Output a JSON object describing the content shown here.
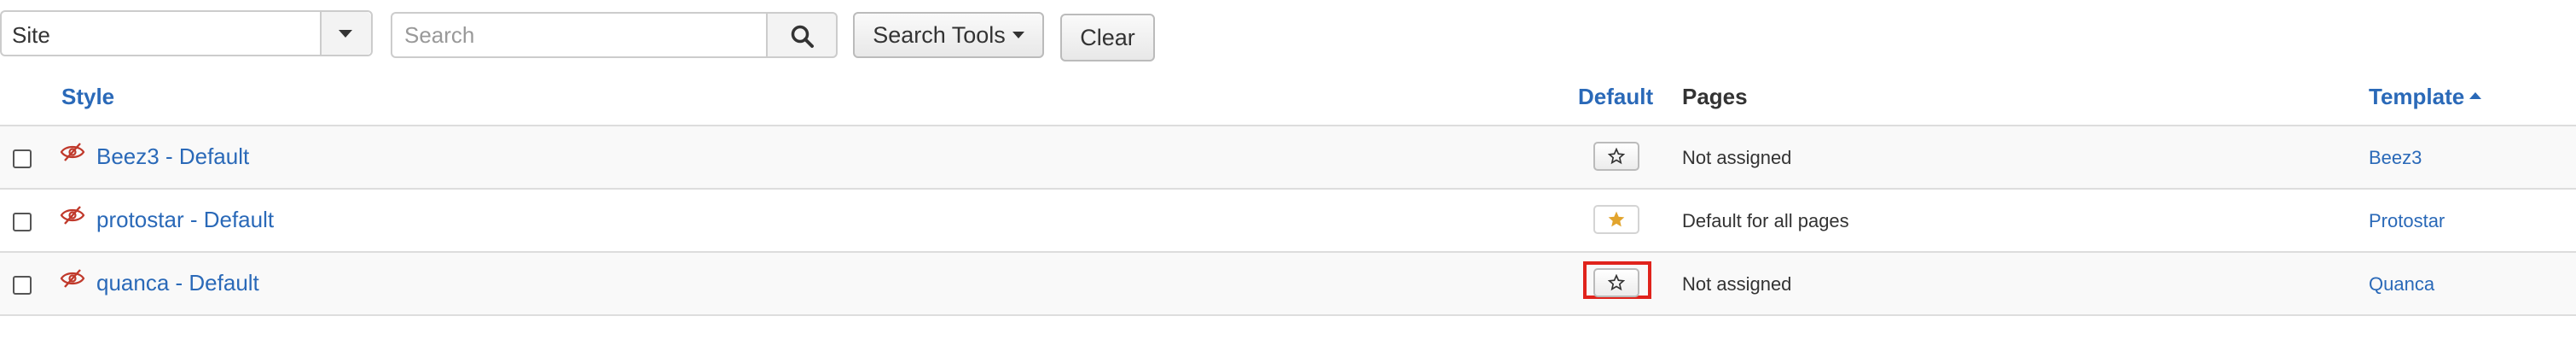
{
  "filters": {
    "client_value": "Site",
    "search_placeholder": "Search",
    "search_tools_label": "Search Tools",
    "clear_label": "Clear"
  },
  "table": {
    "headers": {
      "style": "Style",
      "default": "Default",
      "pages": "Pages",
      "template": "Template"
    },
    "sort": {
      "column": "template",
      "direction": "ascending"
    },
    "rows": [
      {
        "style": "Beez3 - Default",
        "is_default": false,
        "pages": "Not assigned",
        "template": "Beez3"
      },
      {
        "style": "protostar - Default",
        "is_default": true,
        "pages": "Default for all pages",
        "template": "Protostar"
      },
      {
        "style": "quanca - Default",
        "is_default": false,
        "pages": "Not assigned",
        "template": "Quanca"
      }
    ]
  },
  "icons": {
    "search": "search-icon",
    "dropdown": "chevron-down-icon",
    "hidden": "eye-slash-icon",
    "star_outline": "star-outline-icon",
    "star_filled": "star-filled-icon"
  },
  "colors": {
    "link": "#2a69b8",
    "star_filled": "#e2a42d",
    "hidden_icon": "#c0392b",
    "highlight": "#e0231c"
  }
}
